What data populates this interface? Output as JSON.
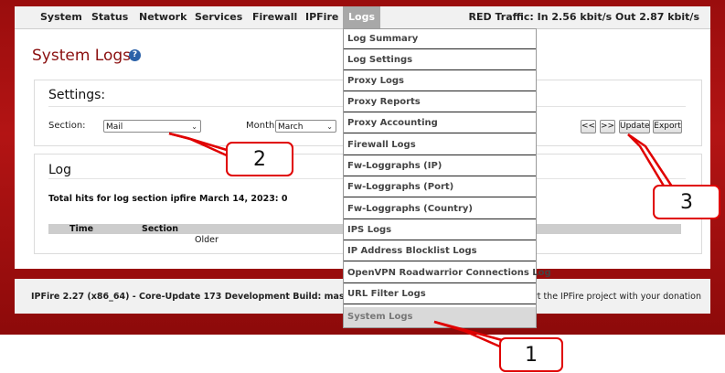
{
  "nav": {
    "items": [
      "System",
      "Status",
      "Network",
      "Services",
      "Firewall",
      "IPFire",
      "Logs"
    ],
    "active": "Logs",
    "traffic": "RED Traffic: In 2.56 kbit/s   Out 2.87 kbit/s"
  },
  "page": {
    "title": "System Logs",
    "help_icon": "?"
  },
  "settings": {
    "title": "Settings:",
    "section_label": "Section:",
    "section_value": "Mail",
    "month_label": "Month:",
    "month_value": "March",
    "btn_prev": "<<",
    "btn_next": ">>",
    "btn_update": "Update",
    "btn_export": "Export"
  },
  "log": {
    "title": "Log",
    "hits": "Total hits for log section ipfire March 14, 2023: 0",
    "col_time": "Time",
    "col_section": "Section",
    "older": "Older"
  },
  "footer": {
    "left": "IPFire 2.27 (x86_64) - Core-Update 173 Development Build: maste",
    "right": "ort the IPFire project with your donation"
  },
  "dropdown": {
    "items": [
      "Log Summary",
      "Log Settings",
      "Proxy Logs",
      "Proxy Reports",
      "Proxy Accounting",
      "Firewall Logs",
      "Fw-Loggraphs (IP)",
      "Fw-Loggraphs (Port)",
      "Fw-Loggraphs (Country)",
      "IPS Logs",
      "IP Address Blocklist Logs",
      "OpenVPN Roadwarrior Connections Log",
      "URL Filter Logs",
      "System Logs"
    ],
    "selected": "System Logs"
  },
  "callouts": {
    "one": "1",
    "two": "2",
    "three": "3"
  },
  "colors": {
    "frame_red": "#b31414",
    "title_red": "#8b1010",
    "callout_red": "#e00000"
  }
}
